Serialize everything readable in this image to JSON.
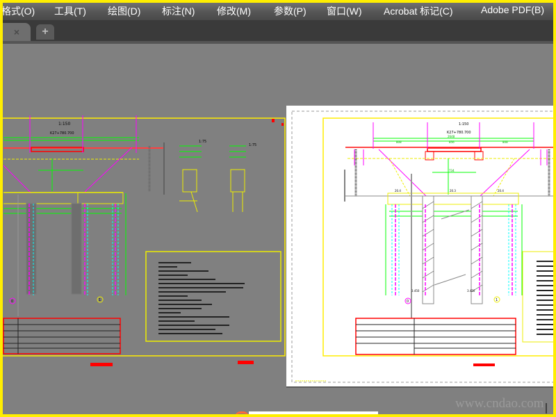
{
  "menubar": {
    "items": [
      "格式(O)",
      "工具(T)",
      "绘图(D)",
      "标注(N)",
      "修改(M)",
      "参数(P)",
      "窗口(W)",
      "Acrobat 标记(C)",
      "Adobe PDF(B)"
    ]
  },
  "tabs": {
    "close_glyph": "×",
    "new_tab_glyph": "+"
  },
  "drawing": {
    "left_sheet": {
      "elevation_scale": "1:150",
      "station": "K27+780.700",
      "detail_scale_1": "1:75",
      "detail_scale_2": "1:75",
      "axis_0": "0",
      "axis_1": "1"
    },
    "right_sheet": {
      "elevation_scale": "1:150",
      "station": "K27+780.700",
      "dim_total": "2648",
      "dim_left": "808",
      "dim_mid": "856",
      "dim_right": "808",
      "dim_inner": "734",
      "elev_left": "20.4",
      "elev_mid": "20.3",
      "elev_right": "20.4",
      "level_left": "3.450",
      "level_right": "3.450",
      "axis_0": "0",
      "axis_1": "1"
    }
  },
  "watermark": "www.cndao.com",
  "colors": {
    "frame_yellow": "#ffee00",
    "dim_green": "#00ff00",
    "pile_magenta": "#ff00ff",
    "pile_cyan": "#00ffff",
    "red": "#ff0000"
  }
}
